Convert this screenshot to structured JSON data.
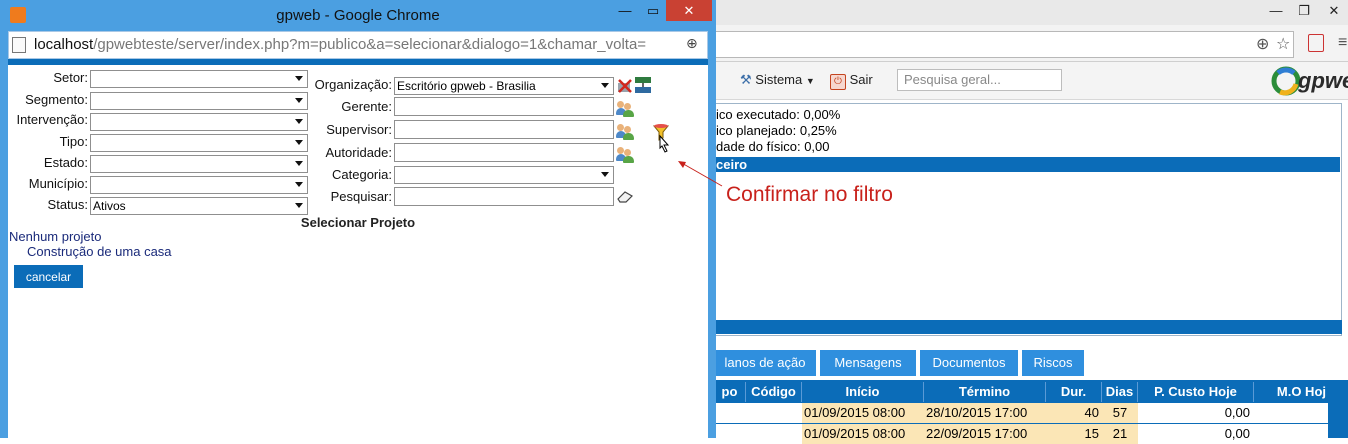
{
  "background_window": {
    "controls": {
      "minimize": "—",
      "restore": "❐",
      "close": "✕"
    },
    "toolbar": {
      "sistema_label": "Sistema",
      "sair_label": "Sair",
      "search_placeholder": "Pesquisa geral..."
    },
    "logo_text": "gpwe",
    "panel_rows": [
      {
        "label": "ico executado:",
        "value": "0,00%"
      },
      {
        "label": "ico planejado:",
        "value": "0,25%"
      },
      {
        "label": "dade do físico:",
        "value": "0,00"
      }
    ],
    "section_header": "ceiro",
    "tabs": [
      "lanos de ação",
      "Mensagens",
      "Documentos",
      "Riscos"
    ],
    "grid": {
      "headers": [
        "po",
        "Código",
        "Início",
        "Término",
        "Dur.",
        "Dias",
        "P. Custo Hoje",
        "M.O Hoj"
      ],
      "rows": [
        {
          "inicio": "01/09/2015 08:00",
          "termino": "28/10/2015 17:00",
          "dur": "40",
          "dias": "57",
          "custo": "0,00"
        },
        {
          "inicio": "01/09/2015 08:00",
          "termino": "22/09/2015 17:00",
          "dur": "15",
          "dias": "21",
          "custo": "0,00"
        }
      ]
    }
  },
  "popup": {
    "title": "gpweb - Google Chrome",
    "controls": {
      "minimize": "—",
      "maximize": "▭",
      "close": "✕"
    },
    "url_host": "localhost",
    "url_path": "/gpwebteste/server/index.php?m=publico&a=selecionar&dialogo=1&chamar_volta=",
    "form_left": [
      {
        "label": "Setor:",
        "value": ""
      },
      {
        "label": "Segmento:",
        "value": ""
      },
      {
        "label": "Intervenção:",
        "value": ""
      },
      {
        "label": "Tipo:",
        "value": ""
      },
      {
        "label": "Estado:",
        "value": ""
      },
      {
        "label": "Município:",
        "value": ""
      },
      {
        "label": "Status:",
        "value": "Ativos"
      }
    ],
    "form_right": {
      "organizacao": {
        "label": "Organização:",
        "value": "Escritório gpweb - Brasilia"
      },
      "gerente": {
        "label": "Gerente:",
        "value": ""
      },
      "supervisor": {
        "label": "Supervisor:",
        "value": ""
      },
      "autoridade": {
        "label": "Autoridade:",
        "value": ""
      },
      "categoria": {
        "label": "Categoria:",
        "value": ""
      },
      "pesquisar": {
        "label": "Pesquisar:",
        "value": ""
      }
    },
    "section_title": "Selecionar Projeto",
    "results": {
      "empty_label": "Nenhum projeto",
      "item": "Construção de uma casa"
    },
    "cancel_label": "cancelar"
  },
  "annotation": {
    "text": "Confirmar no filtro",
    "color": "#c8211b"
  },
  "colors": {
    "accent_blue": "#0b6cb8",
    "tab_blue": "#2f8fde",
    "popup_frame": "#4b9fe1",
    "close_red": "#c94133",
    "highlight_yellow": "#fbe6b6"
  }
}
